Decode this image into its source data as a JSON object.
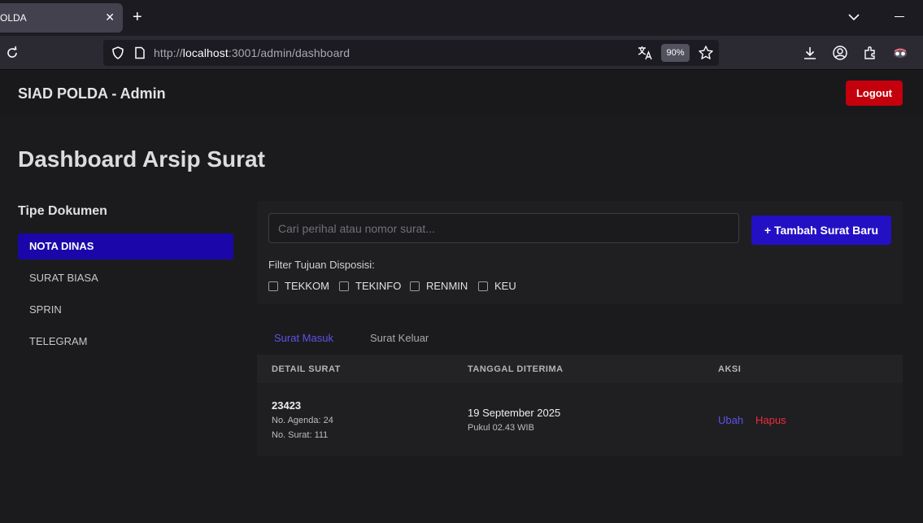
{
  "browser": {
    "tab_title": "OLDA",
    "url_prefix": "http://",
    "url_host": "localhost",
    "url_rest": ":3001/admin/dashboard",
    "zoom": "90%"
  },
  "header": {
    "brand": "SIAD POLDA - Admin",
    "logout_label": "Logout"
  },
  "page": {
    "title": "Dashboard Arsip Surat"
  },
  "sidebar": {
    "title": "Tipe Dokumen",
    "items": [
      {
        "label": "NOTA DINAS",
        "active": true
      },
      {
        "label": "SURAT BIASA",
        "active": false
      },
      {
        "label": "SPRIN",
        "active": false
      },
      {
        "label": "TELEGRAM",
        "active": false
      }
    ]
  },
  "filters": {
    "search_placeholder": "Cari perihal atau nomor surat...",
    "add_label": "+ Tambah Surat Baru",
    "disposisi_label": "Filter Tujuan Disposisi:",
    "options": [
      "TEKKOM",
      "TEKINFO",
      "RENMIN",
      "KEU"
    ]
  },
  "tabs": {
    "masuk": "Surat Masuk",
    "keluar": "Surat Keluar"
  },
  "table": {
    "headers": [
      "DETAIL SURAT",
      "TANGGAL DITERIMA",
      "AKSI"
    ],
    "rows": [
      {
        "title": "23423",
        "agenda": "No. Agenda: 24",
        "nomor": "No. Surat: 111",
        "date": "19 September 2025",
        "time": "Pukul 02.43 WIB",
        "edit": "Ubah",
        "delete": "Hapus"
      }
    ]
  },
  "colors": {
    "accent": "#2410c4",
    "active_item": "#1a06a9",
    "danger": "#c4000d",
    "link": "#5d52e6",
    "delete": "#ef2c38"
  }
}
